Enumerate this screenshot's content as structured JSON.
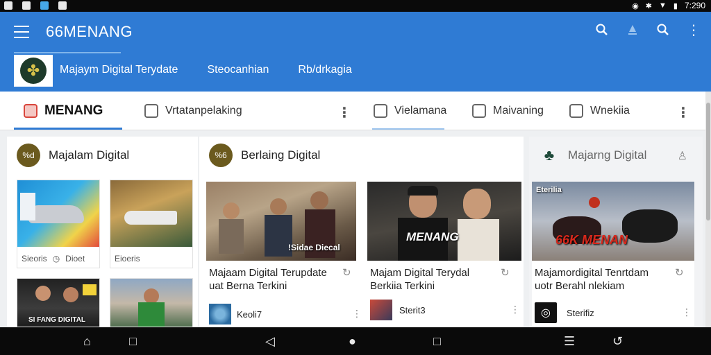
{
  "status_bar": {
    "time": "7:290",
    "icons": [
      "photo-icon",
      "grid-icon",
      "app-icon",
      "gallery-icon",
      "alarm-icon",
      "bluetooth-icon",
      "wifi-icon",
      "battery-icon"
    ]
  },
  "app_bar": {
    "title": "66MENANG",
    "actions": [
      "search-icon",
      "upload-icon",
      "search-icon",
      "more-vert-icon"
    ],
    "sub_tabs": [
      "Majaym Digital Terydate",
      "Steocanhian",
      "Rb/drkagia"
    ]
  },
  "tabs": [
    {
      "label": "MENANG",
      "icon": "news-icon",
      "active": true
    },
    {
      "label": "Vrtatanpelaking",
      "icon": "chat-icon"
    },
    {
      "label": "Vielamana",
      "icon": "frame-icon"
    },
    {
      "label": "Maivaning",
      "icon": "list-icon"
    },
    {
      "label": "Wnekiia",
      "icon": "image-icon"
    }
  ],
  "columns": {
    "left": {
      "badge": "%d",
      "title": "Majalam Digital",
      "thumbs": [
        {
          "caption": "Sieoris",
          "extra": "Dioet"
        },
        {
          "caption": "Eioeris"
        }
      ],
      "thumbs_bottom": [
        {
          "label": "SI FANG DIGITAL"
        },
        {}
      ]
    },
    "middle": {
      "badge": "%6",
      "title": "Berlaing Digital",
      "cards": [
        {
          "image_label": "!Sidae Diecal",
          "title": "Majaam Digital Terupdate uat Berna Terkini",
          "author": "Keoli7"
        },
        {
          "image_label": "MENANG",
          "title": "Majam Digital Terydal Berkiia Terkini",
          "author": "Sterit3"
        }
      ]
    },
    "right": {
      "title": "Majarng Digital",
      "card": {
        "image_tag": "Eterilia",
        "image_label": "66K MENAN",
        "title": "Majamordigital Tenrtdam uotr Berahl nlekiam",
        "author": "Sterifiz"
      }
    }
  },
  "colors": {
    "primary": "#2f7bd4",
    "badge": "#6b5a1e",
    "status_bar": "#0a0a0a"
  },
  "nav_bar": [
    "home-icon",
    "square-icon",
    "back-icon",
    "circle-icon",
    "recent-icon",
    "menu-icon",
    "undo-icon"
  ]
}
